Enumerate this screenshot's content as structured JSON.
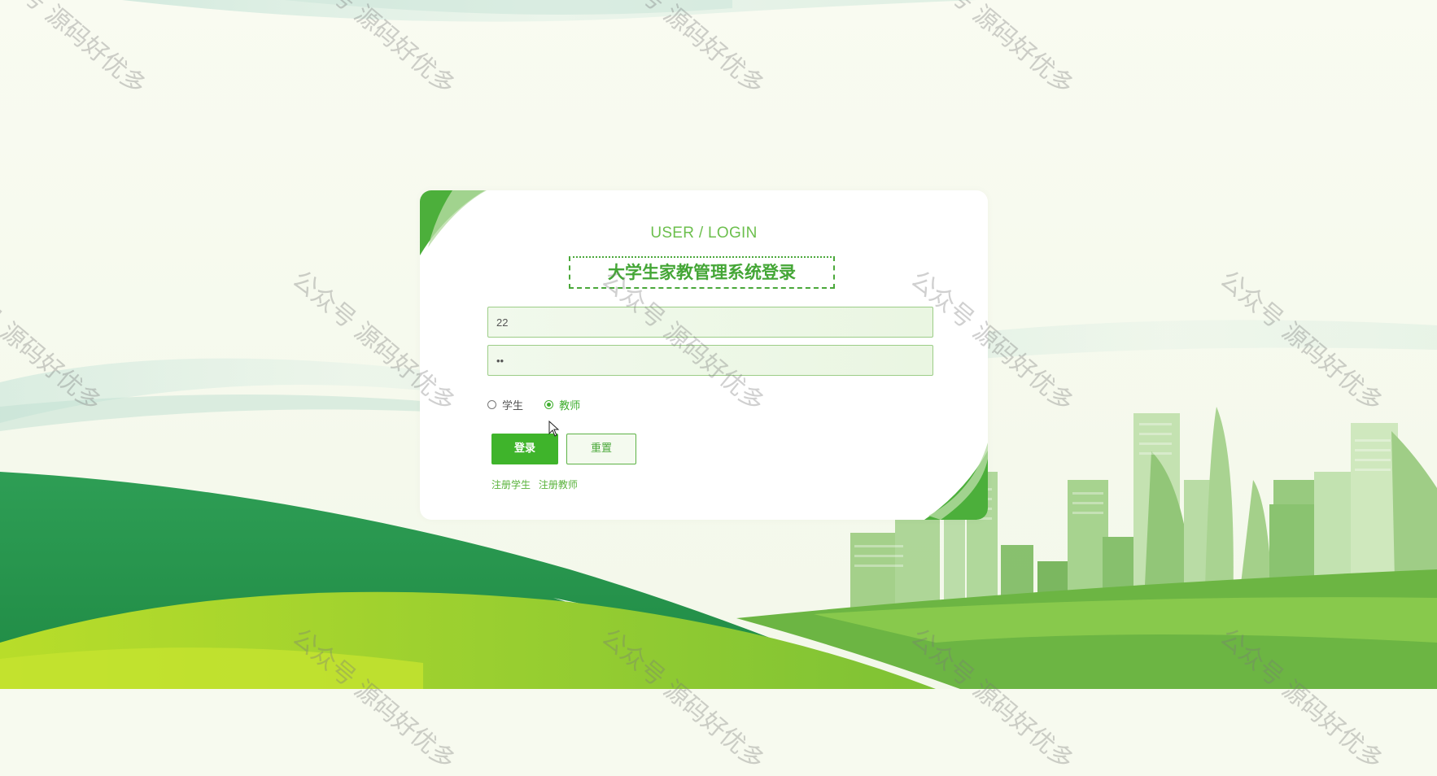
{
  "login": {
    "subtitle": "USER / LOGIN",
    "title": "大学生家教管理系统登录",
    "username_value": "22",
    "password_value": "22",
    "roles": [
      {
        "label": "学生",
        "checked": false
      },
      {
        "label": "教师",
        "checked": true
      }
    ],
    "login_button": "登录",
    "reset_button": "重置",
    "register_student": "注册学生",
    "register_teacher": "注册教师"
  },
  "watermark": {
    "text": "公众号 源码好优多"
  },
  "colors": {
    "accent": "#3fb42b",
    "accent_light": "#6cbf4d",
    "dark_green": "#2a9b4f",
    "lime": "#a6d62f"
  },
  "icons": [
    "mouse-cursor-icon",
    "city-skyline-graphic"
  ]
}
